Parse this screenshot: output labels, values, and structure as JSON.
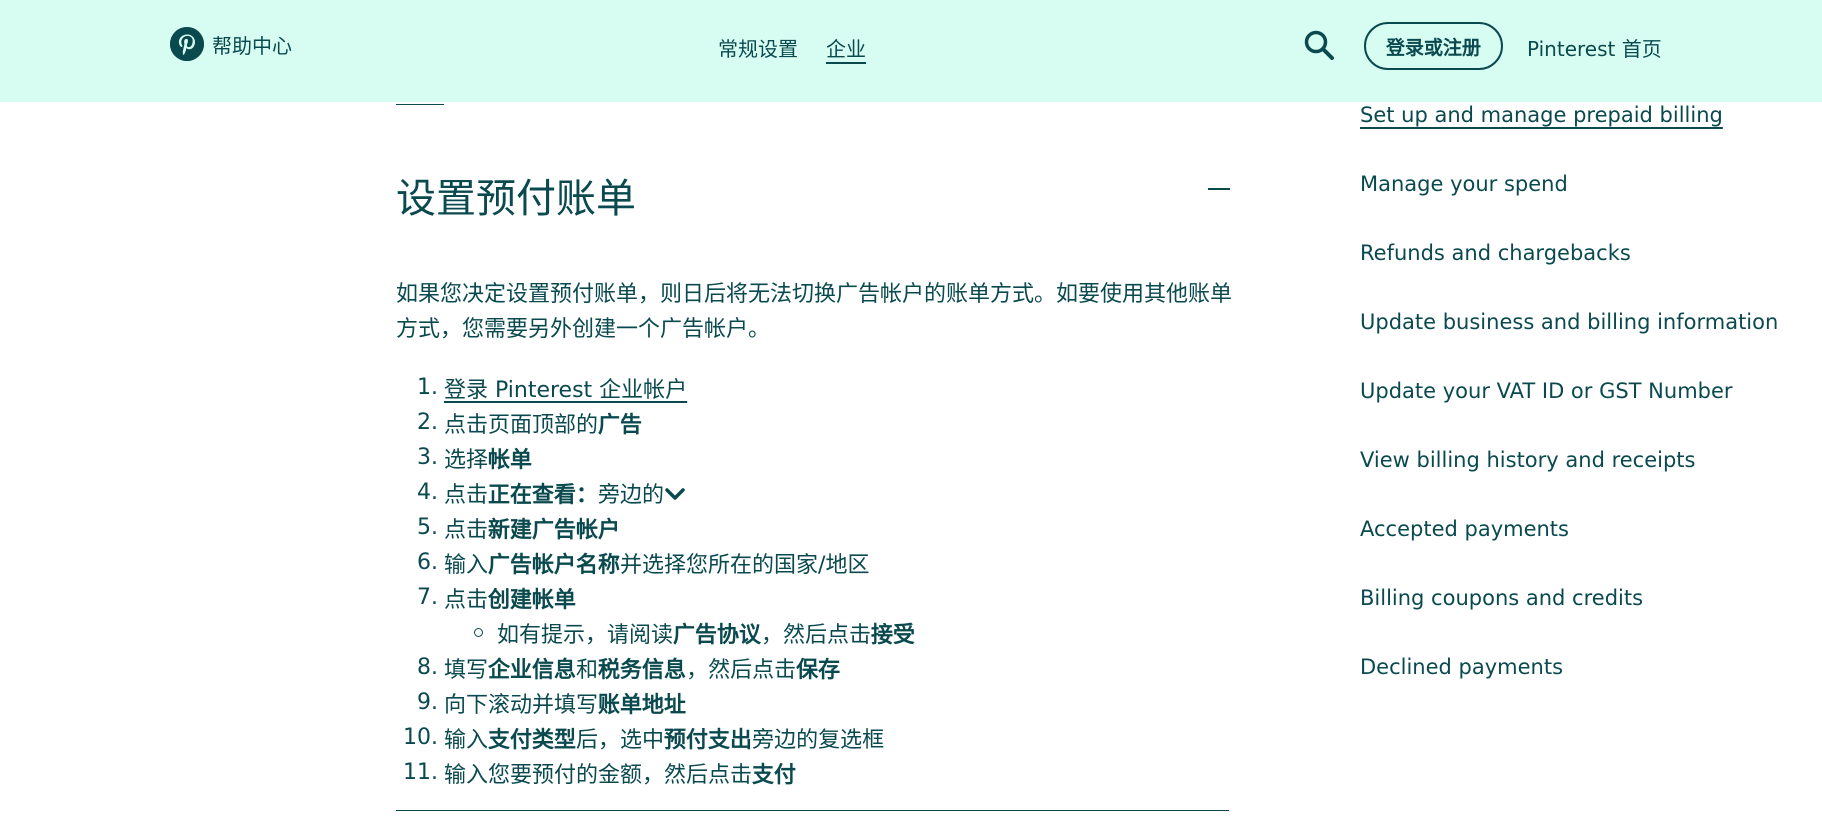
{
  "header": {
    "brand": "帮助中心",
    "nav": [
      {
        "label": "常规设置",
        "active": false
      },
      {
        "label": "企业",
        "active": true
      }
    ],
    "search_icon": "search-icon",
    "login_label": "登录或注册",
    "home_label": "Pinterest 首页"
  },
  "colors": {
    "header_bg": "#d7fdf2",
    "text": "#0a4a4f"
  },
  "article": {
    "section_title": "设置预付账单",
    "collapse_icon": "minus-icon",
    "intro": "如果您决定设置预付账单，则日后将无法切换广告帐户的账单方式。如要使用其他账单方式，您需要另外创建一个广告帐户。",
    "steps": {
      "s1": {
        "num": "1.",
        "link": "登录 Pinterest 企业帐户"
      },
      "s2": {
        "num": "2.",
        "pre": "点击页面顶部的",
        "bold": "广告"
      },
      "s3": {
        "num": "3.",
        "pre": "选择",
        "bold": "帐单"
      },
      "s4": {
        "num": "4.",
        "pre": "点击",
        "bold": "正在查看：",
        "post": "旁边的"
      },
      "s5": {
        "num": "5.",
        "pre": "点击",
        "bold": "新建广告帐户"
      },
      "s6": {
        "num": "6.",
        "pre": "输入",
        "bold": "广告帐户名称",
        "post": "并选择您所在的国家/地区"
      },
      "s7": {
        "num": "7.",
        "pre": "点击",
        "bold": "创建帐单"
      },
      "s7a": {
        "pre": "如有提示，请阅读",
        "bold": "广告协议",
        "mid": "，然后点击",
        "bold2": "接受"
      },
      "s8": {
        "num": "8.",
        "pre": "填写",
        "bold": "企业信息",
        "mid": "和",
        "bold2": "税务信息",
        "mid2": "，然后点击",
        "bold3": "保存"
      },
      "s9": {
        "num": "9.",
        "pre": "向下滚动并填写",
        "bold": "账单地址"
      },
      "s10": {
        "num": "10.",
        "pre": "输入",
        "bold": "支付类型",
        "mid": "后，选中",
        "bold2": "预付支出",
        "post": "旁边的复选框"
      },
      "s11": {
        "num": "11.",
        "pre": "输入您要预付的金额，然后点击",
        "bold": "支付"
      }
    }
  },
  "sidebar": {
    "items": [
      "Set up and manage prepaid billing",
      "Manage your spend",
      "Refunds and chargebacks",
      "Update business and billing information",
      "Update your VAT ID or GST Number",
      "View billing history and receipts",
      "Accepted payments",
      "Billing coupons and credits",
      "Declined payments"
    ]
  }
}
